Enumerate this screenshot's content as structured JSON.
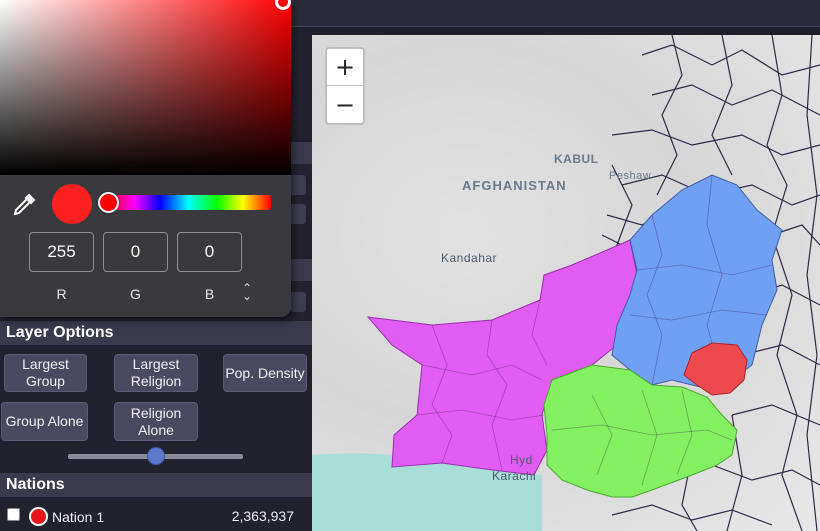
{
  "sidebar": {
    "layer_options_title": "Layer Options",
    "layer_buttons": [
      {
        "label": "Largest Group"
      },
      {
        "label": "Largest Religion"
      },
      {
        "label": "Pop. Density"
      },
      {
        "label": "Group Alone"
      },
      {
        "label": "Religion Alone"
      }
    ],
    "opacity_slider_level": 0.5,
    "nations_title": "Nations",
    "nations": [
      {
        "name": "Nation 1",
        "population": "2,363,937",
        "color": "#e8141b"
      }
    ]
  },
  "color_picker": {
    "hex": "#ff2020",
    "r": "255",
    "g": "0",
    "b": "0",
    "labels": {
      "r": "R",
      "g": "G",
      "b": "B"
    },
    "mode_toggle": "⇕",
    "hue_position": 0.0
  },
  "map": {
    "zoom_in": "+",
    "zoom_out": "−",
    "labels": {
      "kabul": "KABUL",
      "afghanistan": "AFGHANISTAN",
      "kandahar": "Kandahar",
      "peshawar": "Peshaw",
      "karachi": "Karachi",
      "hyd": "Hyd"
    },
    "region_colors": {
      "magenta": "#e05cf2",
      "blue": "#6fa0f4",
      "green": "#82f060",
      "red": "#ee4a4e",
      "outline": "#2a2a48"
    }
  }
}
